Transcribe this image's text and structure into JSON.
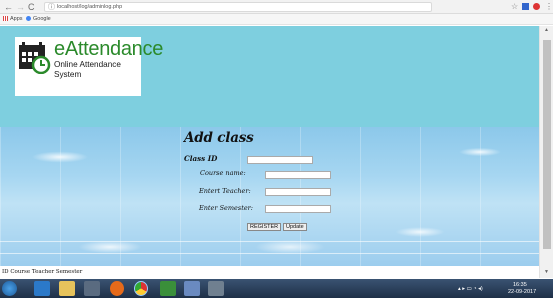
{
  "browser": {
    "url": "localhost/log/adminlog.php",
    "bookmarks": [
      {
        "label": "Apps",
        "icon": "apps-grid-icon"
      },
      {
        "label": "Google",
        "icon": "google-icon"
      }
    ]
  },
  "logo": {
    "title": "eAttendance",
    "subtitle": "Online Attendance System"
  },
  "form": {
    "title": "Add class",
    "fields": [
      {
        "label": "Class ID",
        "value": ""
      },
      {
        "label": "Course name:",
        "value": ""
      },
      {
        "label": "Entert Teacher:",
        "value": ""
      },
      {
        "label": "Enter Semester:",
        "value": ""
      }
    ],
    "register_label": "REGISTER",
    "update_label": "Update"
  },
  "footer_text": "ID Course Teacher Semester",
  "taskbar": {
    "time": "16:35",
    "date": "22-09-2017"
  },
  "colors": {
    "header_bg": "#7ecfdf",
    "logo_green": "#2b8a2b",
    "taskbar_bg": "#1e2f47"
  }
}
